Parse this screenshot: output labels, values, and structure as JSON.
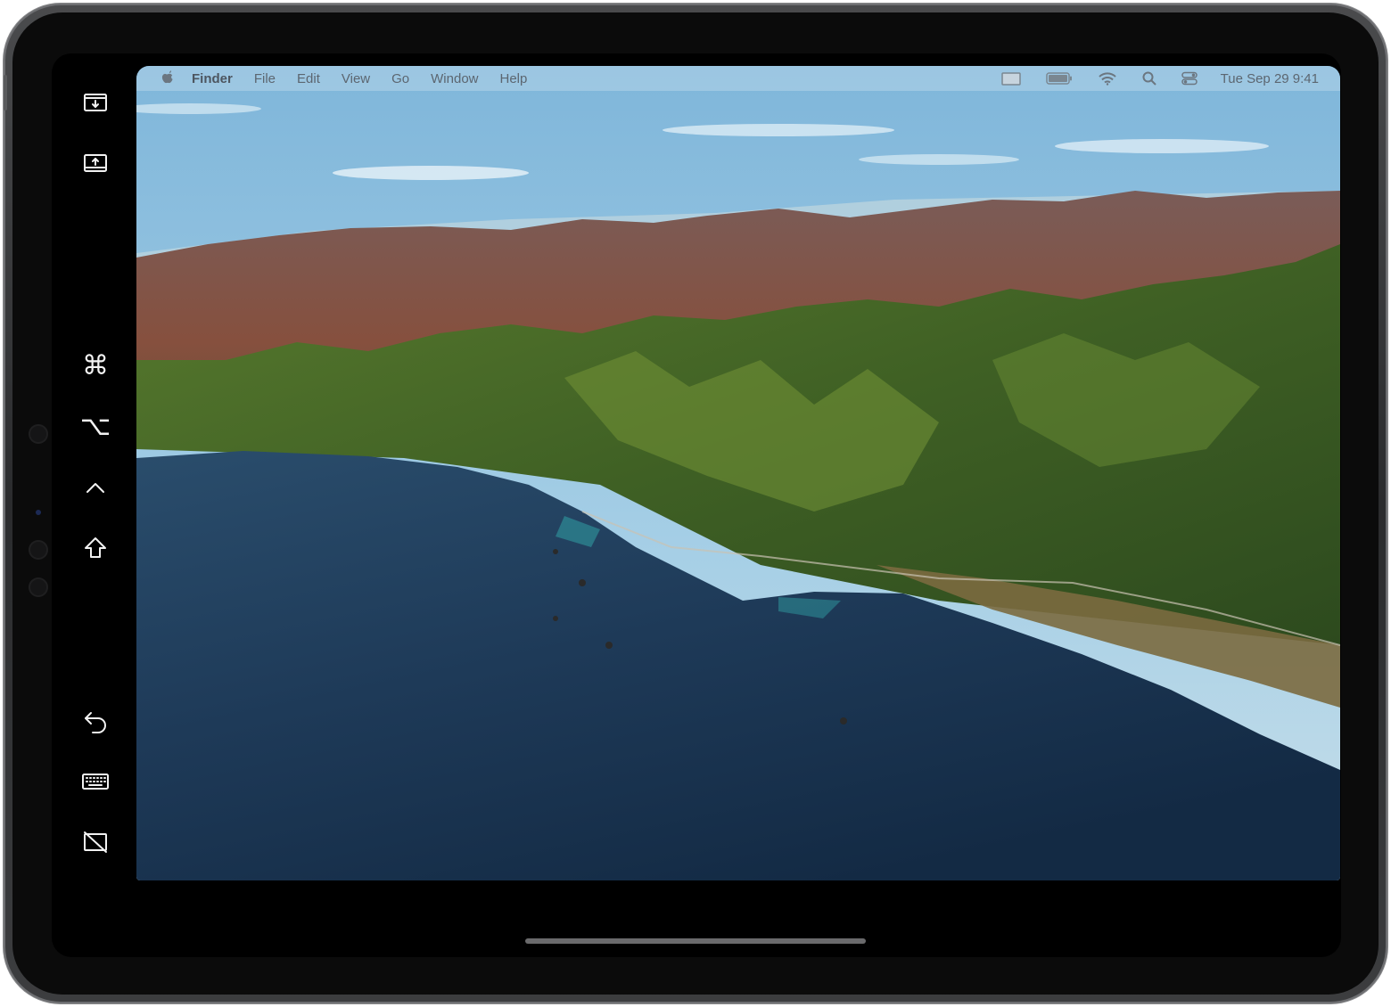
{
  "menubar": {
    "app_name": "Finder",
    "items": [
      "File",
      "Edit",
      "View",
      "Go",
      "Window",
      "Help"
    ],
    "clock": "Tue Sep 29  9:41"
  },
  "sidebar": {
    "buttons": [
      {
        "name": "show-menubar-icon"
      },
      {
        "name": "show-dock-icon"
      },
      {
        "name": "command-key-icon"
      },
      {
        "name": "option-key-icon"
      },
      {
        "name": "control-key-icon"
      },
      {
        "name": "shift-key-icon"
      },
      {
        "name": "undo-icon"
      },
      {
        "name": "keyboard-icon"
      },
      {
        "name": "disconnect-icon"
      }
    ]
  },
  "wallpaper": {
    "name": "macOS Big Sur coastline",
    "colors": {
      "sky": "#8fc3e2",
      "ocean": "#1c3550",
      "hills": "#4c6a2a",
      "mountains": "#7a4a3c"
    }
  }
}
